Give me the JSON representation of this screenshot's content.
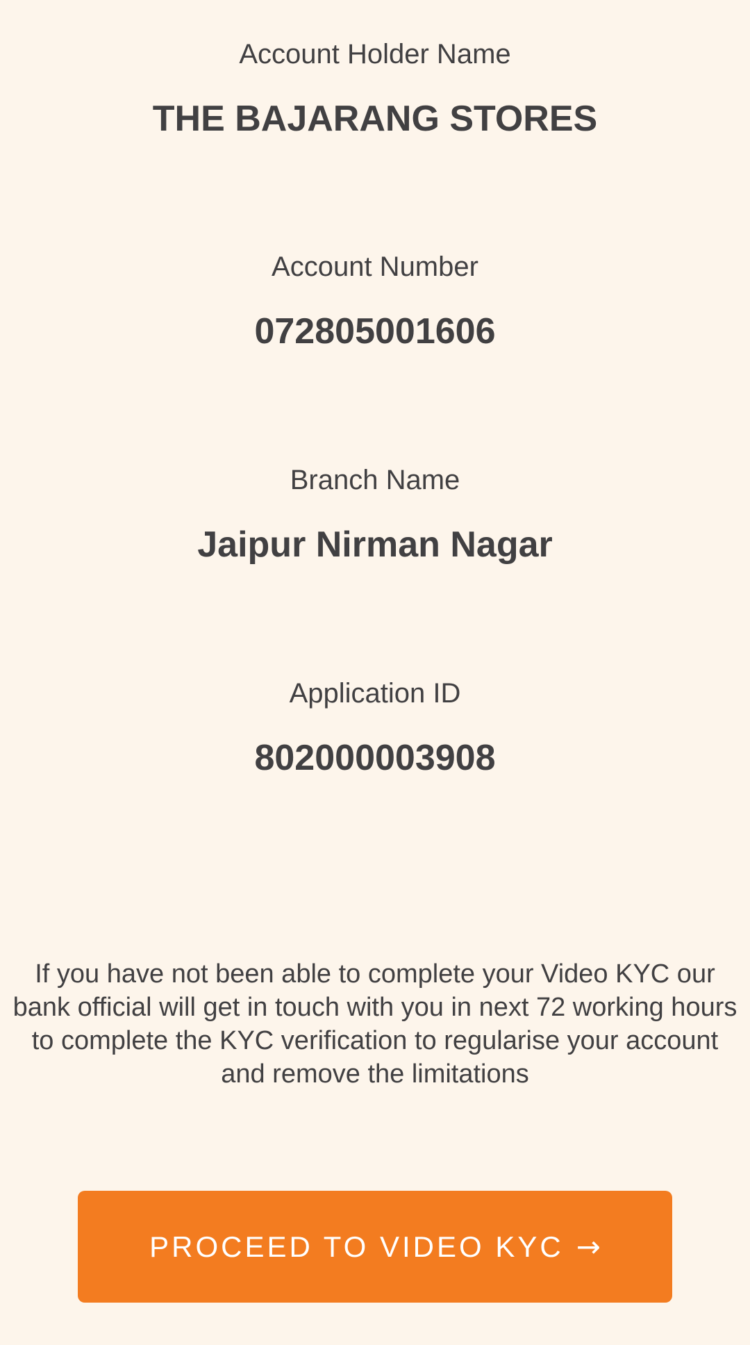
{
  "account_holder": {
    "label": "Account Holder Name",
    "value": "THE BAJARANG STORES"
  },
  "account_number": {
    "label": "Account Number",
    "value": "072805001606"
  },
  "branch": {
    "label": "Branch Name",
    "value": "Jaipur Nirman Nagar"
  },
  "application": {
    "label": "Application ID",
    "value": "802000003908"
  },
  "notice": "If you have not been able to complete your Video KYC our bank official will get in touch with you in next 72 working hours to complete the KYC verification to regularise your account and remove the limitations",
  "cta": {
    "label": "PROCEED TO VIDEO KYC",
    "icon": "arrow-right-icon",
    "glyph": "→",
    "color": "#f37c20"
  },
  "colors": {
    "background": "#fdf5eb",
    "text": "#414042"
  }
}
